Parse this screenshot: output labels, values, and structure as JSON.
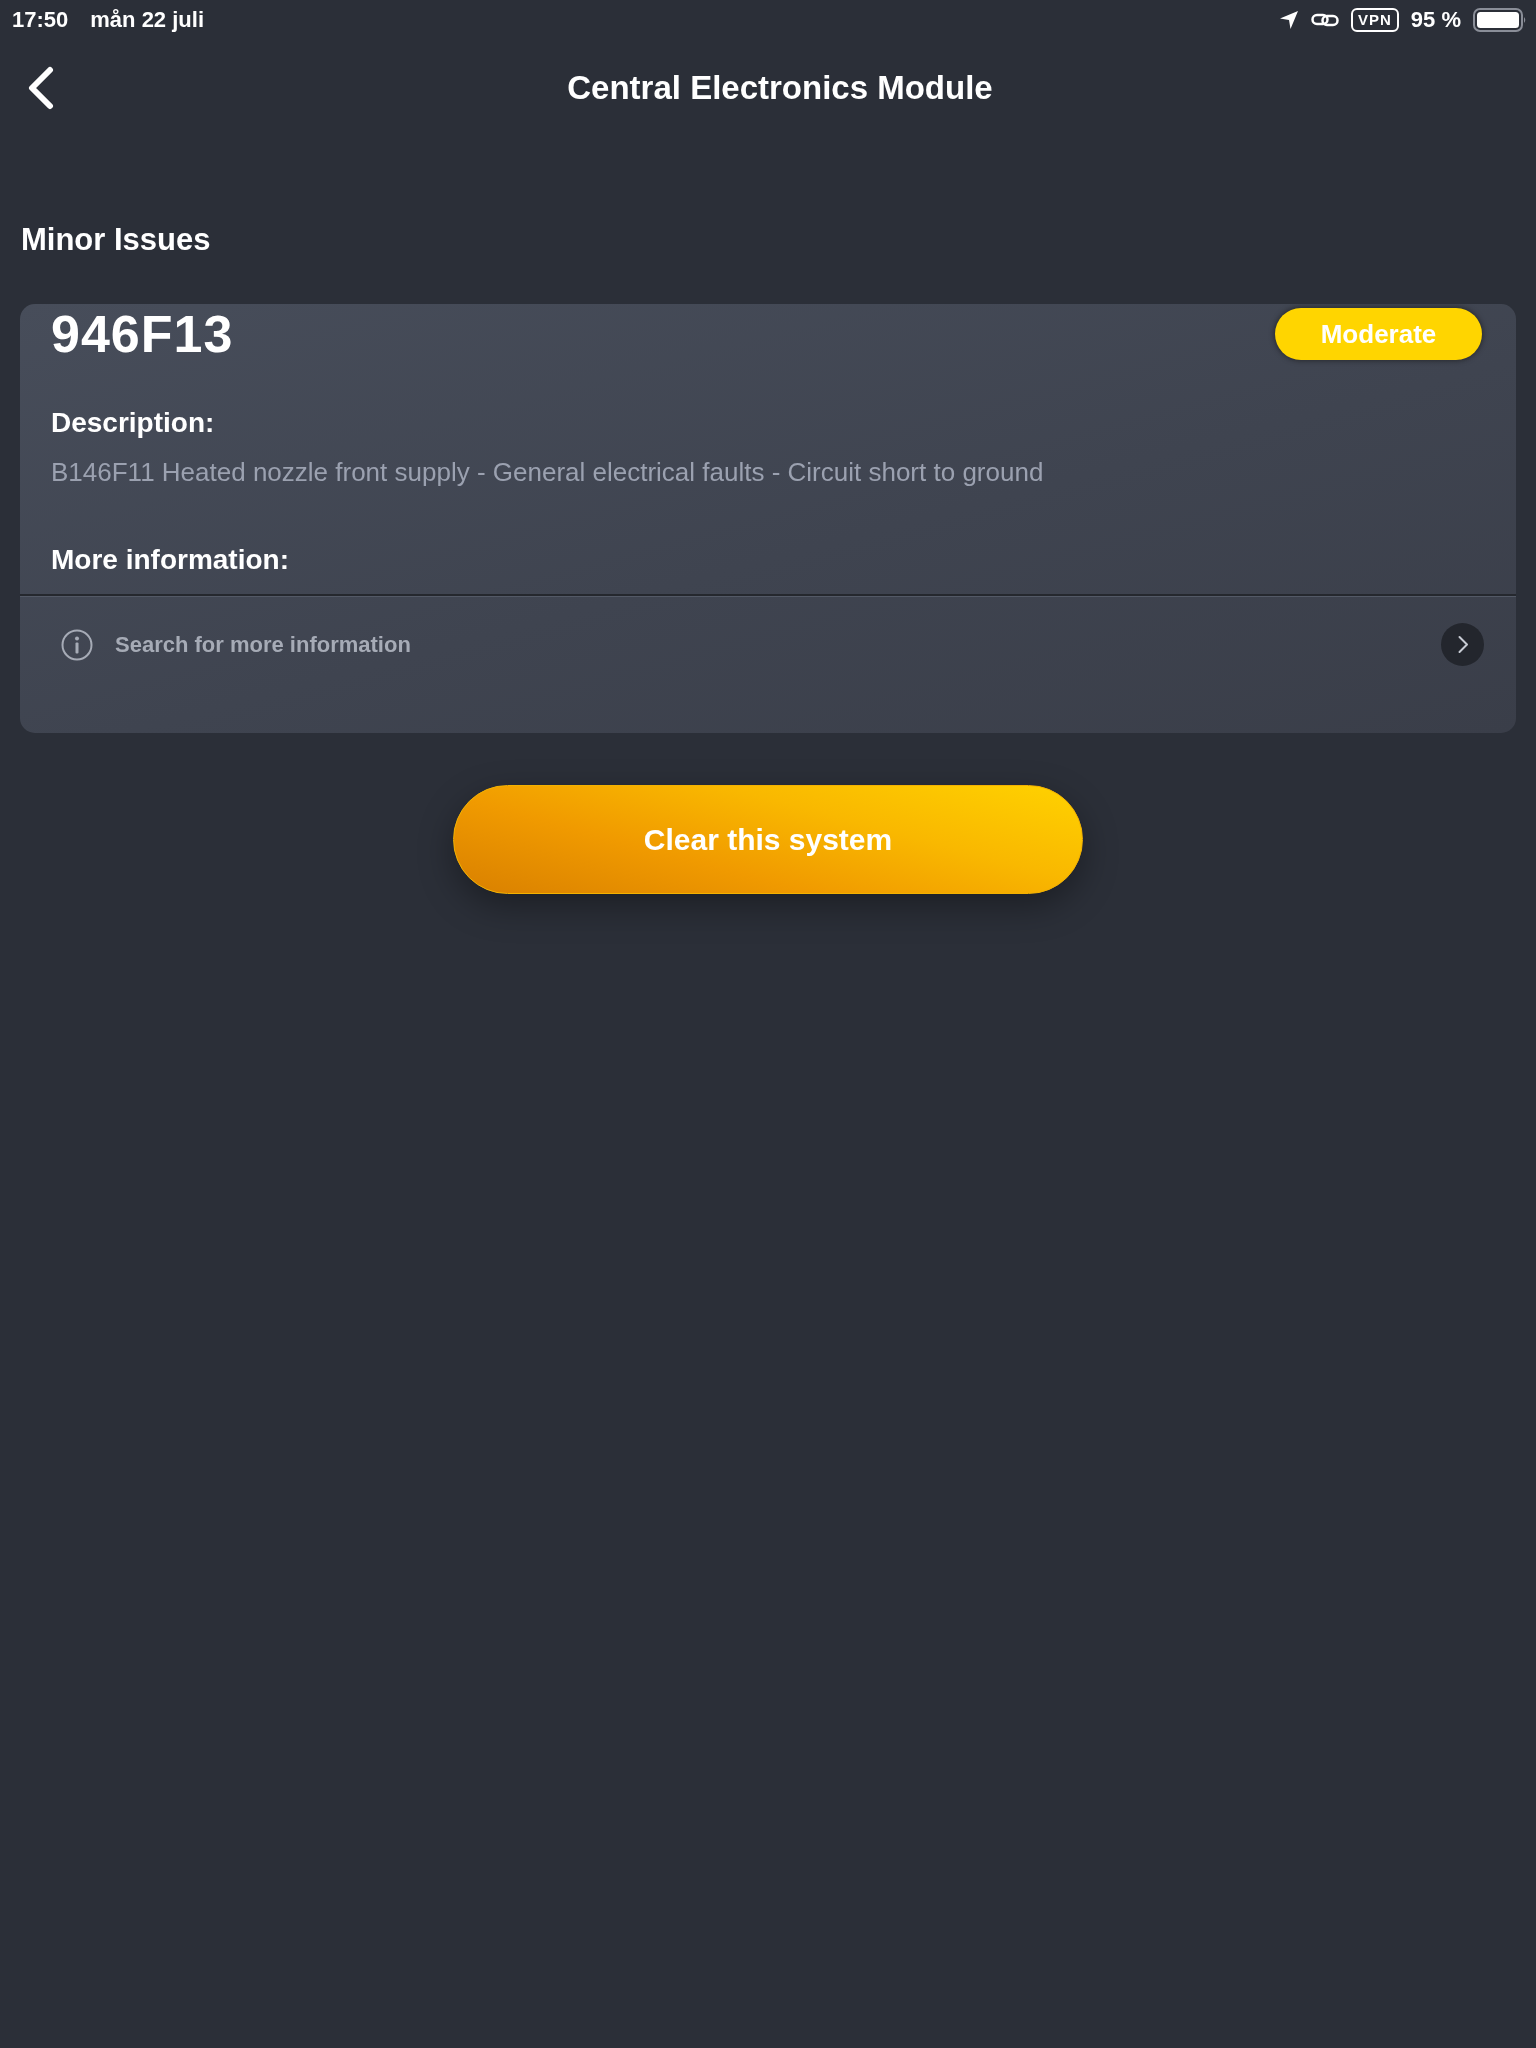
{
  "status_bar": {
    "time": "17:50",
    "date": "mån 22 juli",
    "vpn": "VPN",
    "battery": "95 %"
  },
  "header": {
    "title": "Central Electronics Module"
  },
  "section": {
    "title": "Minor Issues"
  },
  "issues": [
    {
      "code": "946F13",
      "severity": "Moderate",
      "color": "#ffd500",
      "description_label": "Description:",
      "description": "B146F11 Heated nozzle front supply - General electrical faults - Circuit short to ground",
      "more_info_label": "More information:",
      "search_label": "Search for more information"
    }
  ],
  "action_button": {
    "label": "Clear this system"
  }
}
